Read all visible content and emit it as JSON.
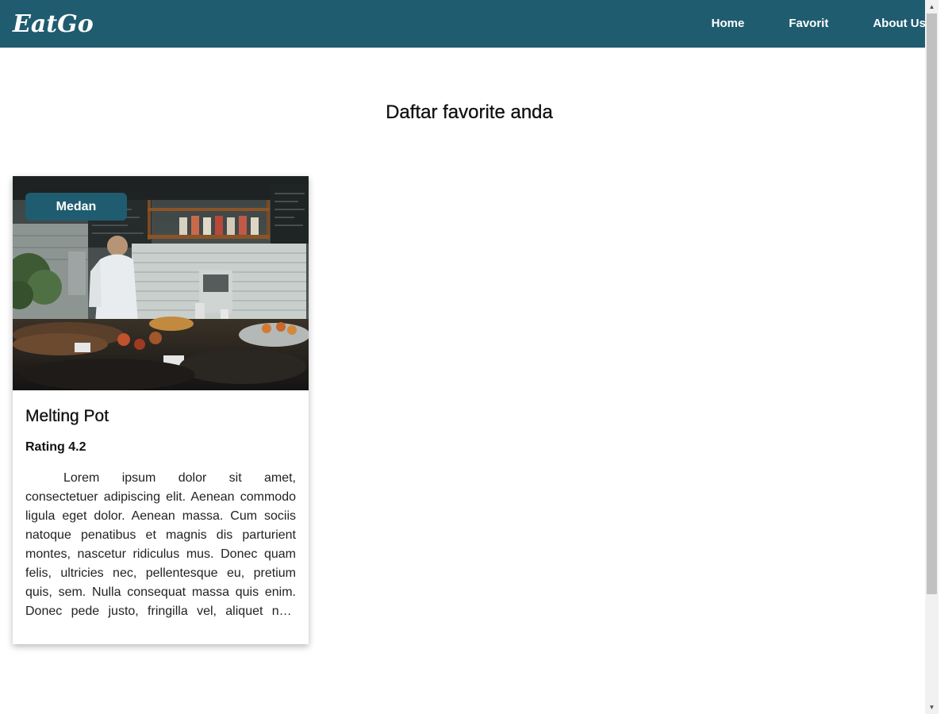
{
  "navbar": {
    "logo": "EatGo",
    "links": [
      {
        "label": "Home"
      },
      {
        "label": "Favorit"
      },
      {
        "label": "About Us"
      }
    ],
    "background": "#1f5c70"
  },
  "main": {
    "heading": "Daftar favorite anda",
    "restaurants": [
      {
        "city": "Medan",
        "name": "Melting Pot",
        "rating": "Rating 4.2",
        "description": "Lorem ipsum dolor sit amet, consectetuer adipiscing elit. Aenean commodo ligula eget dolor. Aenean massa. Cum sociis natoque penatibus et magnis dis parturient montes, nascetur ridiculus mus. Donec quam felis, ultricies nec, pellentesque eu, pretium quis, sem. Nulla consequat massa quis enim. Donec pede justo, fringilla vel, aliquet nec, vulputate eget, arcu."
      }
    ]
  },
  "scrollbar": {
    "up_icon": "triangle-up",
    "down_icon": "triangle-down"
  }
}
